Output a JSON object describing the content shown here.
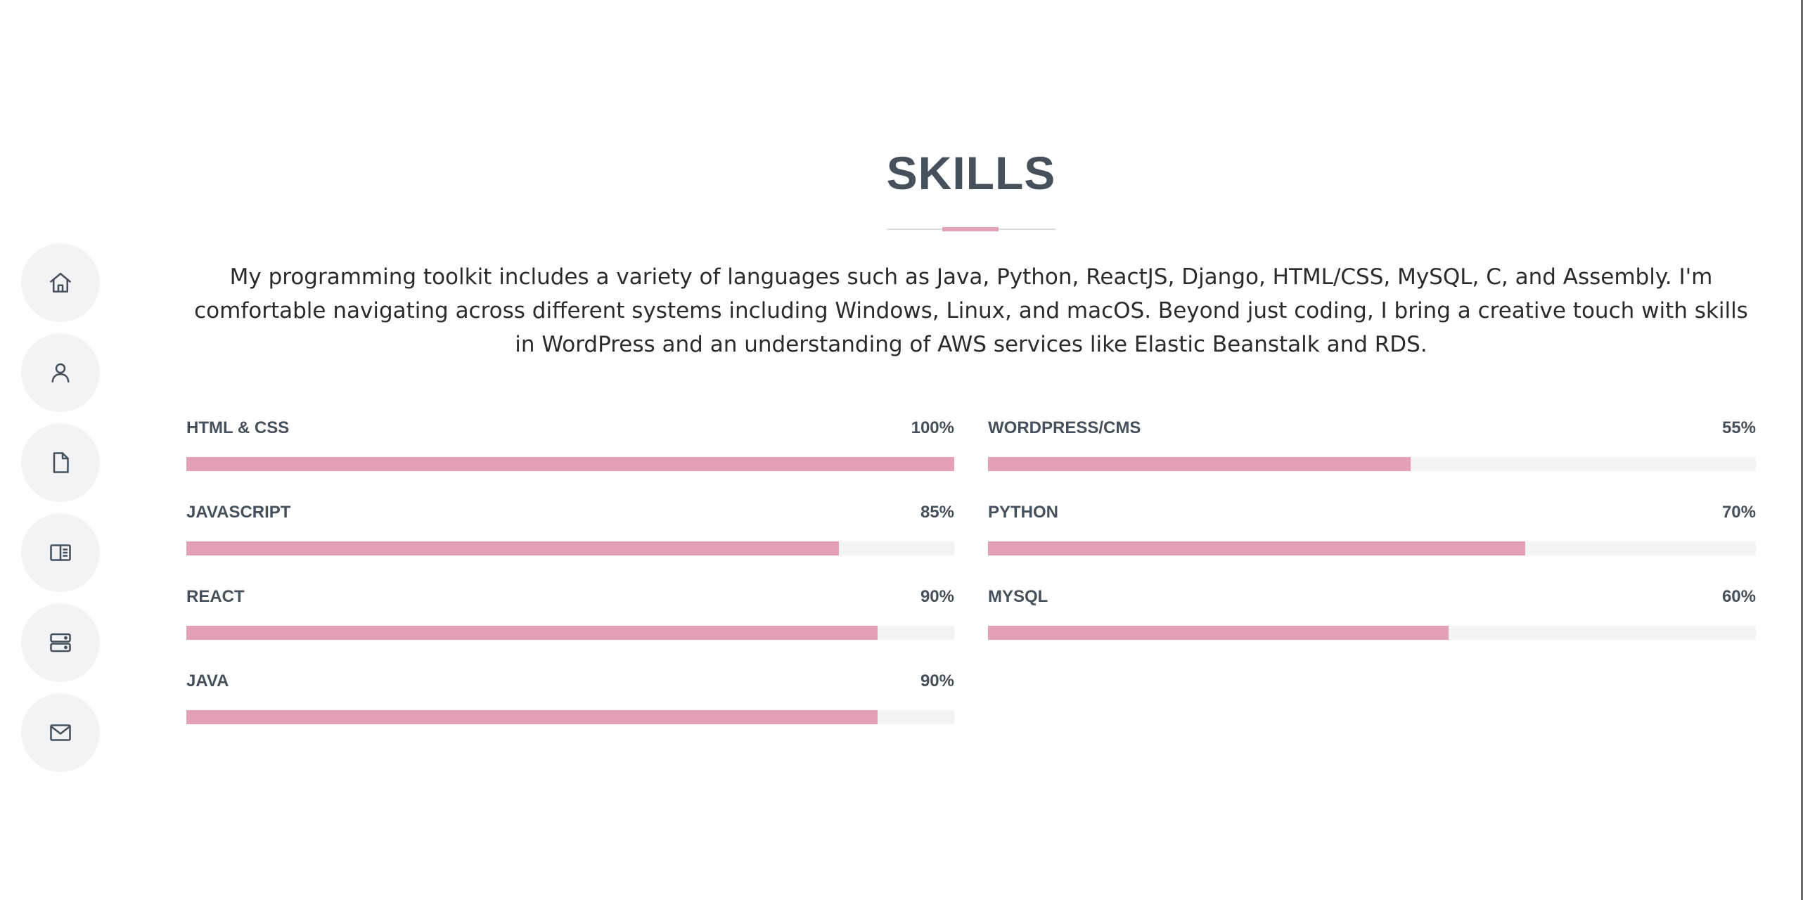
{
  "nav": {
    "items": [
      {
        "icon": "home-icon",
        "label": "Home"
      },
      {
        "icon": "user-icon",
        "label": "About"
      },
      {
        "icon": "file-icon",
        "label": "Resume"
      },
      {
        "icon": "book-icon",
        "label": "Portfolio"
      },
      {
        "icon": "server-icon",
        "label": "Services"
      },
      {
        "icon": "envelope-icon",
        "label": "Contact"
      }
    ]
  },
  "section": {
    "title": "SKILLS",
    "intro": "My programming toolkit includes a variety of languages such as Java, Python, ReactJS, Django, HTML/CSS, MySQL, C, and Assembly. I'm comfortable navigating across different systems including Windows, Linux, and macOS. Beyond just coding, I bring a creative touch with skills in WordPress and an understanding of AWS services like Elastic Beanstalk and RDS."
  },
  "skills": {
    "left": [
      {
        "name": "HTML & CSS",
        "value": "100%",
        "percent": 100
      },
      {
        "name": "JAVASCRIPT",
        "value": "85%",
        "percent": 85
      },
      {
        "name": "REACT",
        "value": "90%",
        "percent": 90
      },
      {
        "name": "JAVA",
        "value": "90%",
        "percent": 90
      }
    ],
    "right": [
      {
        "name": "WORDPRESS/CMS",
        "value": "55%",
        "percent": 55
      },
      {
        "name": "PYTHON",
        "value": "70%",
        "percent": 70
      },
      {
        "name": "MYSQL",
        "value": "60%",
        "percent": 60
      }
    ]
  },
  "colors": {
    "accent": "#e3a0b8",
    "track": "#f2f3f5",
    "text": "#45505b"
  }
}
